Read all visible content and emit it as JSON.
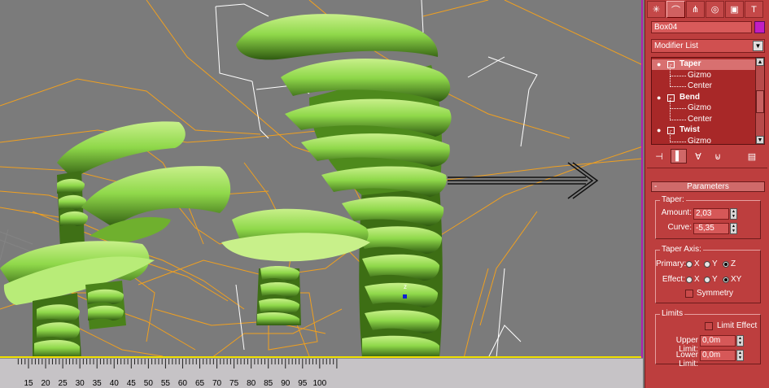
{
  "panel": {
    "tabs": [
      "create-tab",
      "modify-tab",
      "hierarchy-tab",
      "motion-tab",
      "display-tab",
      "utilities-tab"
    ],
    "object_name": "Box04",
    "object_color": "#c21ec2",
    "modifier_list_label": "Modifier List",
    "stack": [
      {
        "name": "Taper",
        "type": "modifier",
        "selected": true
      },
      {
        "name": "Gizmo",
        "type": "sub"
      },
      {
        "name": "Center",
        "type": "sub"
      },
      {
        "name": "Bend",
        "type": "modifier"
      },
      {
        "name": "Gizmo",
        "type": "sub"
      },
      {
        "name": "Center",
        "type": "sub"
      },
      {
        "name": "Twist",
        "type": "modifier"
      },
      {
        "name": "Gizmo",
        "type": "sub"
      }
    ],
    "rollout": {
      "title": "Parameters",
      "taper_group": "Taper:",
      "amount_label": "Amount:",
      "amount_value": "2,03",
      "curve_label": "Curve:",
      "curve_value": "-5,35",
      "axis_group": "Taper Axis:",
      "primary_label": "Primary:",
      "effect_label": "Effect:",
      "primary_options": [
        "X",
        "Y",
        "Z"
      ],
      "primary_selected": "Z",
      "effect_options": [
        "X",
        "Y",
        "XY"
      ],
      "effect_selected": "XY",
      "symmetry_label": "Symmetry",
      "limits_group": "Limits",
      "limit_effect_label": "Limit Effect",
      "upper_limit_label": "Upper Limit:",
      "upper_limit_value": "0,0m",
      "lower_limit_label": "Lower Limit:",
      "lower_limit_value": "0,0m"
    }
  },
  "timeline": {
    "ticks": [
      "15",
      "20",
      "25",
      "30",
      "35",
      "40",
      "45",
      "50",
      "55",
      "60",
      "65",
      "70",
      "75",
      "80",
      "85",
      "90",
      "95",
      "100"
    ]
  },
  "colors": {
    "panel_bg": "#bd3e3e",
    "viewport_bg": "#7b7b7b",
    "geometry": "#8fd84a",
    "wireframe": "#f0a020"
  }
}
